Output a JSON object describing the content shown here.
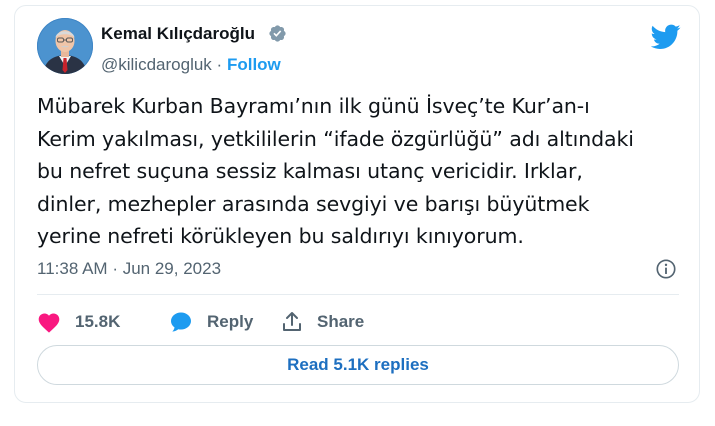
{
  "author": {
    "name": "Kemal Kılıçdaroğlu",
    "handle": "@kilicdarogluk",
    "separator": "·",
    "follow_label": "Follow",
    "verified": true
  },
  "tweet": {
    "lines": [
      "Mübarek Kurban Bayramı’nın ilk günü İsveç’te Kur’an-ı",
      "Kerim yakılması, yetkililerin “ifade özgürlüğü” adı altındaki",
      "bu nefret suçuna sessiz kalması utanç vericidir. Irklar,",
      "dinler, mezhepler arasında sevgiyi ve barışı büyütmek",
      "yerine nefreti körükleyen bu saldırıyı kınıyorum."
    ]
  },
  "meta": {
    "time": "11:38 AM",
    "separator": "·",
    "date": "Jun 29, 2023"
  },
  "actions": {
    "likes_count": "15.8K",
    "reply_label": "Reply",
    "share_label": "Share"
  },
  "replies_button": {
    "label": "Read 5.1K replies"
  },
  "colors": {
    "accent": "#1d9bf0",
    "like": "#f91880",
    "text": "#0f1419",
    "muted": "#536471",
    "border": "#e6ecf0"
  },
  "icons": {
    "brand": "twitter-bird-icon",
    "verified": "verified-badge-icon",
    "info": "info-icon",
    "like": "heart-icon",
    "reply": "speech-bubble-icon",
    "share": "share-upload-icon"
  }
}
